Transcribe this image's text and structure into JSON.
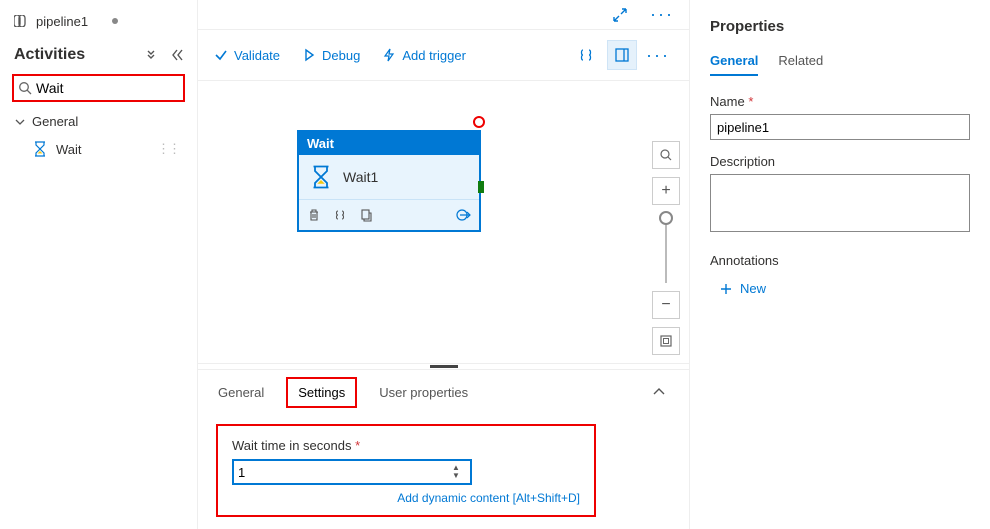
{
  "tab": {
    "name": "pipeline1"
  },
  "sidebar": {
    "title": "Activities",
    "search_value": "Wait",
    "group_label": "General",
    "activity_item": "Wait"
  },
  "toolbar": {
    "validate": "Validate",
    "debug": "Debug",
    "add_trigger": "Add trigger"
  },
  "node": {
    "type": "Wait",
    "name": "Wait1"
  },
  "bottom": {
    "tabs": {
      "general": "General",
      "settings": "Settings",
      "user_props": "User properties"
    },
    "wait_label": "Wait time in seconds",
    "wait_value": "1",
    "dyn_link": "Add dynamic content [Alt+Shift+D]"
  },
  "props": {
    "title": "Properties",
    "tabs": {
      "general": "General",
      "related": "Related"
    },
    "name_label": "Name",
    "name_value": "pipeline1",
    "desc_label": "Description",
    "desc_value": "",
    "annot_label": "Annotations",
    "annot_new": "New"
  }
}
